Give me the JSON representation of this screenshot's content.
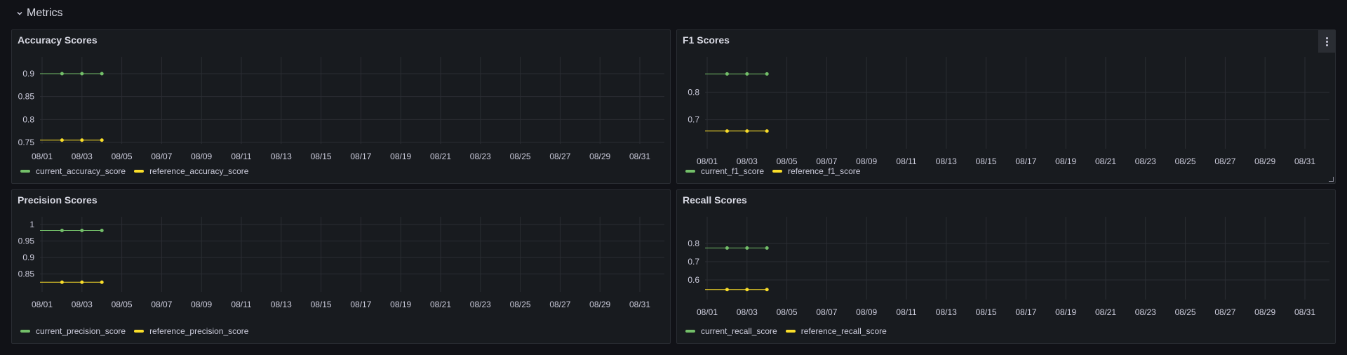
{
  "row": {
    "title": "Metrics"
  },
  "colors": {
    "current": "#73bf69",
    "reference": "#fade2a",
    "grid": "#2a2d33"
  },
  "x_ticks": [
    "08/01",
    "08/03",
    "08/05",
    "08/07",
    "08/09",
    "08/11",
    "08/13",
    "08/15",
    "08/17",
    "08/19",
    "08/21",
    "08/23",
    "08/25",
    "08/27",
    "08/29",
    "08/31"
  ],
  "panels": [
    {
      "title": "Accuracy Scores",
      "legend": [
        "current_accuracy_score",
        "reference_accuracy_score"
      ],
      "chart_data": {
        "type": "line",
        "x": [
          "08/01",
          "08/02",
          "08/03",
          "08/04"
        ],
        "xlim": [
          "08/01",
          "08/31"
        ],
        "yticks": [
          "0.9",
          "0.85",
          "0.8",
          "0.75"
        ],
        "ylim": [
          0.75,
          0.9
        ],
        "series": [
          {
            "name": "current_accuracy_score",
            "values": [
              0.9,
              0.9,
              0.9,
              0.9
            ]
          },
          {
            "name": "reference_accuracy_score",
            "values": [
              0.755,
              0.755,
              0.755,
              0.755
            ]
          }
        ]
      }
    },
    {
      "title": "F1 Scores",
      "legend": [
        "current_f1_score",
        "reference_f1_score"
      ],
      "chart_data": {
        "type": "line",
        "x": [
          "08/01",
          "08/02",
          "08/03",
          "08/04"
        ],
        "xlim": [
          "08/01",
          "08/31"
        ],
        "yticks": [
          "0.8",
          "0.7"
        ],
        "ylim": [
          0.6,
          0.9
        ],
        "series": [
          {
            "name": "current_f1_score",
            "values": [
              0.866,
              0.866,
              0.866,
              0.866
            ]
          },
          {
            "name": "reference_f1_score",
            "values": [
              0.659,
              0.659,
              0.659,
              0.659
            ]
          }
        ]
      }
    },
    {
      "title": "Precision Scores",
      "legend": [
        "current_precision_score",
        "reference_precision_score"
      ],
      "chart_data": {
        "type": "line",
        "x": [
          "08/01",
          "08/02",
          "08/03",
          "08/04"
        ],
        "xlim": [
          "08/01",
          "08/31"
        ],
        "yticks": [
          "1",
          "0.95",
          "0.9",
          "0.85"
        ],
        "ylim": [
          0.8,
          1.0
        ],
        "series": [
          {
            "name": "current_precision_score",
            "values": [
              0.982,
              0.982,
              0.982,
              0.982
            ]
          },
          {
            "name": "reference_precision_score",
            "values": [
              0.825,
              0.825,
              0.825,
              0.825
            ]
          }
        ]
      }
    },
    {
      "title": "Recall Scores",
      "legend": [
        "current_recall_score",
        "reference_recall_score"
      ],
      "chart_data": {
        "type": "line",
        "x": [
          "08/01",
          "08/02",
          "08/03",
          "08/04"
        ],
        "xlim": [
          "08/01",
          "08/31"
        ],
        "yticks": [
          "0.8",
          "0.7",
          "0.6"
        ],
        "ylim": [
          0.5,
          0.9
        ],
        "series": [
          {
            "name": "current_recall_score",
            "values": [
              0.775,
              0.775,
              0.775,
              0.775
            ]
          },
          {
            "name": "reference_recall_score",
            "values": [
              0.547,
              0.547,
              0.547,
              0.547
            ]
          }
        ]
      }
    }
  ]
}
